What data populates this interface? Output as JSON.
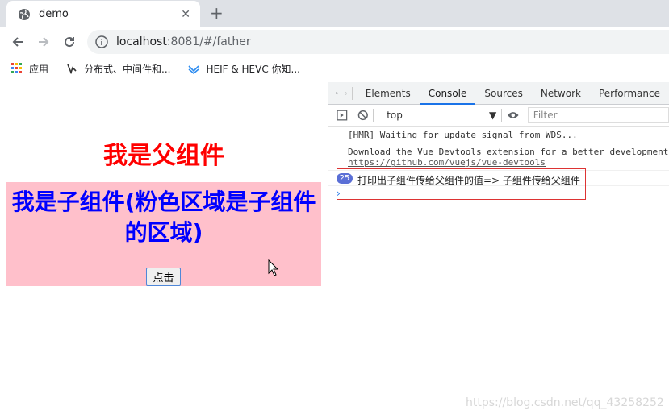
{
  "browser": {
    "tab_title": "demo",
    "tab_close": "✕",
    "new_tab": "+",
    "url_host": "localhost",
    "url_path": ":8081/#/father",
    "bookmarks": [
      {
        "label": "应用",
        "icon": "apps-grid-icon"
      },
      {
        "label": "分布式、中间件和...",
        "icon": "bookmark-icon"
      },
      {
        "label": "HEIF & HEVC 你知...",
        "icon": "bookmark-icon"
      }
    ]
  },
  "page": {
    "father_title": "我是父组件",
    "child_title": "我是子组件(粉色区域是子组件的区域)",
    "button_label": "点击",
    "colors": {
      "father": "#ff0000",
      "child_text": "#0000ff",
      "child_bg": "#ffc0cb"
    }
  },
  "devtools": {
    "tabs": [
      "Elements",
      "Console",
      "Sources",
      "Network",
      "Performance"
    ],
    "active_tab": "Console",
    "context": "top",
    "filter_placeholder": "Filter",
    "lines": [
      {
        "text": "[HMR] Waiting for update signal from WDS..."
      },
      {
        "text": "Download the Vue Devtools extension for a better development",
        "link": "https://github.com/vuejs/vue-devtools"
      }
    ],
    "log_count": "25",
    "log_text": "打印出子组件传给父组件的值=> 子组件传给父组件",
    "prompt": "›"
  },
  "watermark": "https://blog.csdn.net/qq_43258252"
}
